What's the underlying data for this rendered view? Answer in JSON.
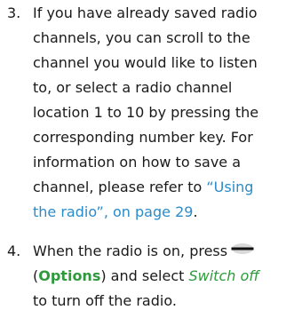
{
  "step3": {
    "number": "3.",
    "lines": [
      "If you have already saved radio",
      "channels, you can scroll to the",
      "channel you would like to listen",
      "to, or select a radio channel",
      "location 1 to 10 by pressing the",
      "corresponding number key. For",
      "information on how to save a",
      "channel, please refer to "
    ],
    "link_part1": "“Using",
    "link_part2": "the radio”, on page 29",
    "trailing": "."
  },
  "step4": {
    "number": "4.",
    "line1": "When the radio is on, press",
    "key_icon": "selection-key-icon",
    "open_paren": "(",
    "options_label": "Options",
    "close_paren_and": ") and select ",
    "switch_off_label": "Switch off",
    "line3": "to turn off the radio."
  },
  "colors": {
    "text": "#1a1a1a",
    "link": "#2a8bc9",
    "emphasis": "#2e9a3c"
  }
}
